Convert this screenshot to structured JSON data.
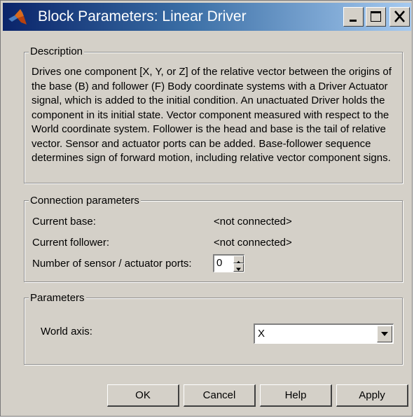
{
  "window": {
    "title": "Block Parameters: Linear Driver",
    "icon": "matlab-logo-icon",
    "controls": [
      "minimize-icon",
      "maximize-icon",
      "close-icon"
    ]
  },
  "description": {
    "legend": "Description",
    "text": "Drives one component [X, Y, or Z] of the relative vector between the origins of the base (B) and follower (F) Body coordinate systems with a Driver Actuator signal, which is added to the initial condition. An unactuated Driver holds the component in its initial state. Vector component measured with respect to the World coordinate system. Follower is the head and base is the tail of relative vector. Sensor and actuator ports can be added. Base-follower sequence determines sign of forward motion, including relative vector component signs."
  },
  "connection": {
    "legend": "Connection parameters",
    "current_base_label": "Current base:",
    "current_base_value": "<not connected>",
    "current_follower_label": "Current follower:",
    "current_follower_value": "<not connected>",
    "ports_label": "Number of sensor / actuator ports:",
    "ports_value": "0"
  },
  "parameters": {
    "legend": "Parameters",
    "world_axis_label": "World axis:",
    "world_axis_value": "X"
  },
  "buttons": {
    "ok": "OK",
    "cancel": "Cancel",
    "help": "Help",
    "apply": "Apply"
  },
  "colors": {
    "dialog_bg": "#d4d0c8",
    "title_gradient_start": "#0a246a",
    "title_gradient_end": "#a6caf0",
    "title_text": "#ffffff"
  }
}
